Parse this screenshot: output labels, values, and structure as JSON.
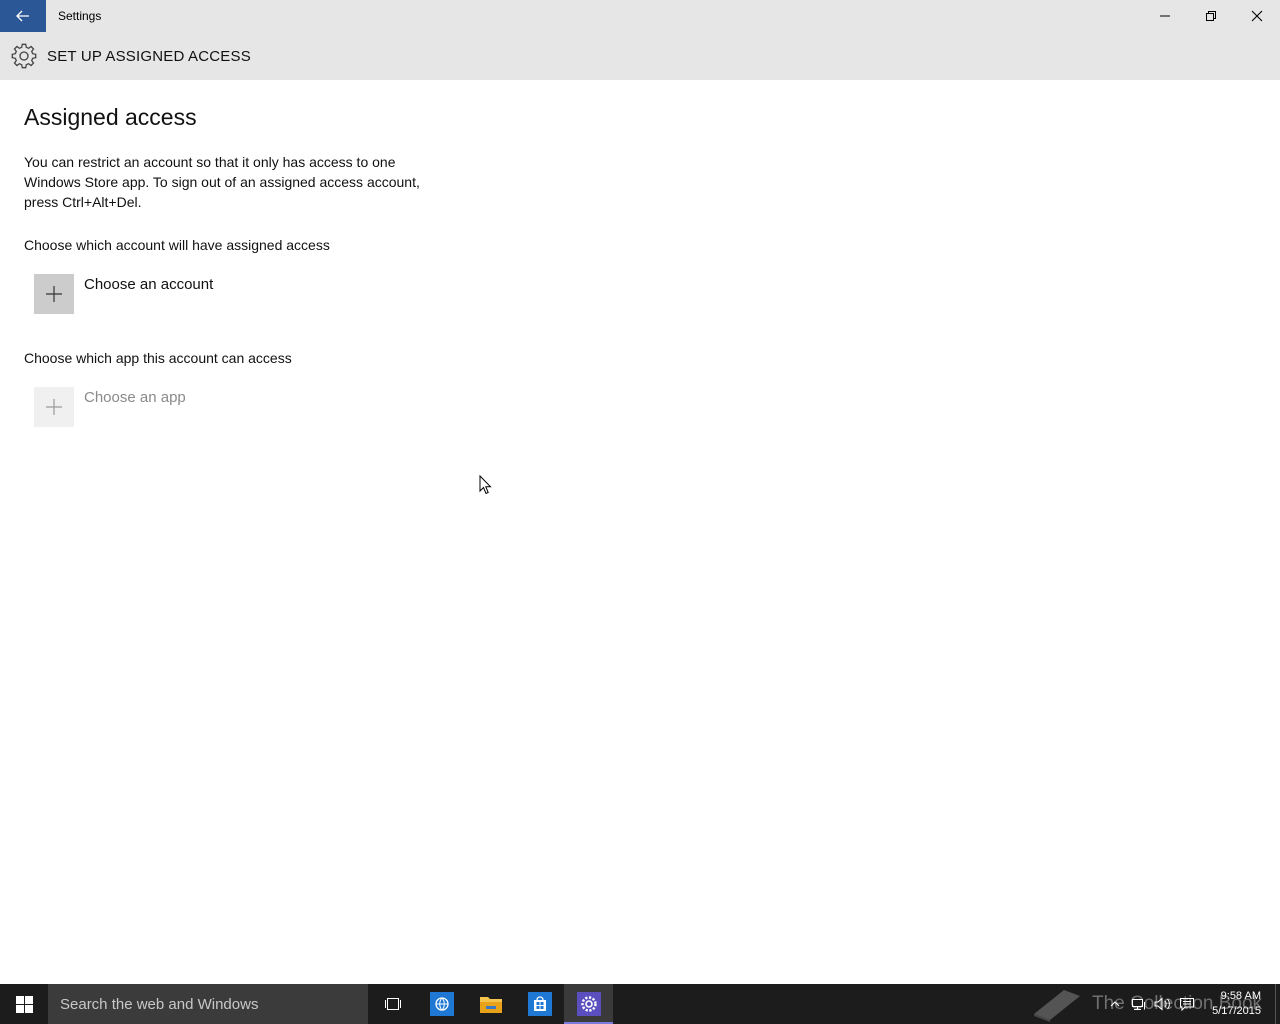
{
  "window": {
    "title": "Settings"
  },
  "header": {
    "title": "SET UP ASSIGNED ACCESS",
    "icon": "gear-icon"
  },
  "main": {
    "title": "Assigned access",
    "description": "You can restrict an account so that it only has access to one Windows Store app. To sign out of an assigned access account, press Ctrl+Alt+Del.",
    "account_section": {
      "label": "Choose which account will have assigned access",
      "button_label": "Choose an account"
    },
    "app_section": {
      "label": "Choose which app this account can access",
      "button_label": "Choose an app",
      "enabled": false
    }
  },
  "taskbar": {
    "search_placeholder": "Search the web and Windows",
    "apps": [
      "task-view-icon",
      "edge-icon",
      "file-explorer-icon",
      "store-icon",
      "settings-icon"
    ],
    "watermark": "The Collection Book",
    "clock": {
      "time": "9:58 AM",
      "date": "5/17/2015"
    }
  },
  "colors": {
    "accent": "#2b5797",
    "header_bg": "#e6e6e6",
    "taskbar_bg": "#1c1c1c",
    "settings_tile": "#5b4fbf"
  }
}
